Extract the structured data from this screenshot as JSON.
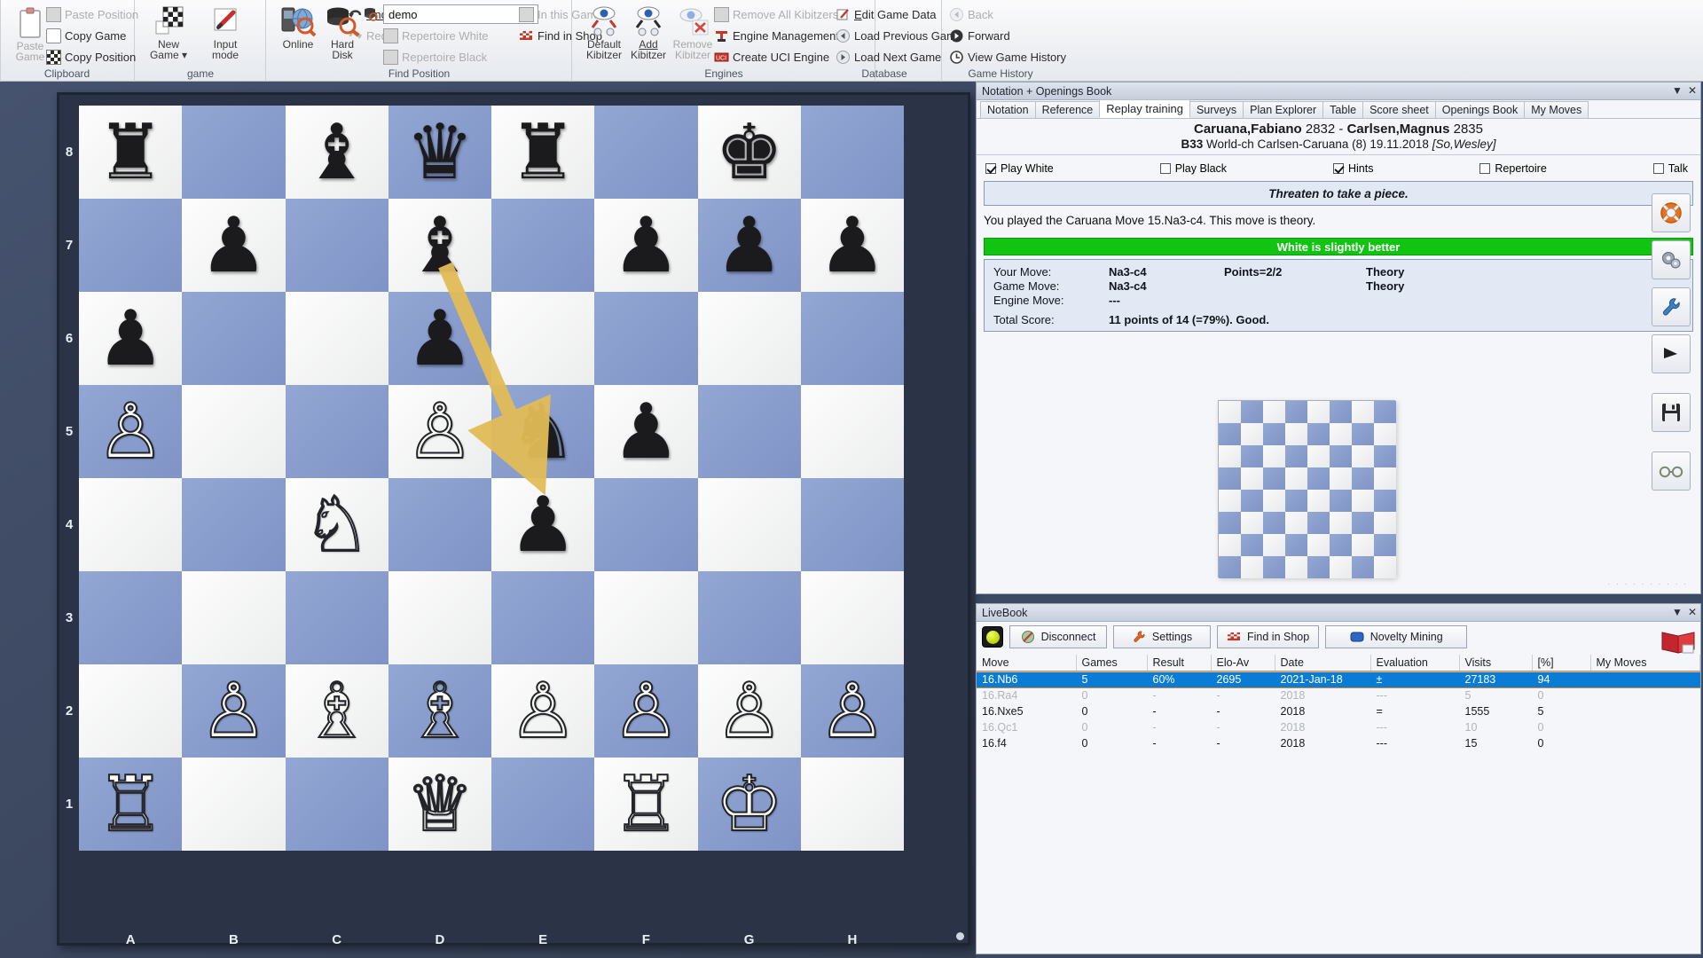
{
  "ribbon": {
    "groups": [
      {
        "name": "Clipboard",
        "label": "Clipboard"
      },
      {
        "name": "game",
        "label": "game"
      },
      {
        "name": "Find Position",
        "label": "Find Position"
      },
      {
        "name": "Engines",
        "label": "Engines"
      },
      {
        "name": "Database",
        "label": "Database"
      },
      {
        "name": "Game History",
        "label": "Game History"
      }
    ],
    "clipboard": {
      "paste_game": "Paste\nGame",
      "paste_game_l1": "Paste",
      "paste_game_l2": "Game",
      "paste_position": "Paste Position",
      "copy_game": "Copy Game",
      "copy_position": "Copy Position"
    },
    "game": {
      "new_game_l1": "New",
      "new_game_l2": "Game",
      "input_mode_l1": "Input",
      "input_mode_l2": "mode",
      "undo": "Undo",
      "redo": "Redo"
    },
    "find_position": {
      "online": "Online",
      "hard_disk_l1": "Hard",
      "hard_disk_l2": "Disk",
      "database_value": "demo",
      "repertoire_white": "Repertoire White",
      "repertoire_black": "Repertoire Black",
      "in_this_game": "In this Game",
      "find_in_shop": "Find in Shop"
    },
    "engines": {
      "default_kibitzer_l1": "Default",
      "default_kibitzer_l2": "Kibitzer",
      "add_kibitzer_l1": "Add",
      "add_kibitzer_l2": "Kibitzer",
      "remove_kibitzer_l1": "Remove",
      "remove_kibitzer_l2": "Kibitzer",
      "remove_all_kibitzers": "Remove All Kibitzers",
      "engine_management": "Engine Management",
      "create_uci_engine": "Create UCI Engine"
    },
    "database": {
      "edit_game_data": "Edit Game Data",
      "load_previous_game": "Load Previous Game",
      "load_next_game": "Load Next Game"
    },
    "game_history": {
      "back": "Back",
      "forward": "Forward",
      "view_game_history": "View Game History"
    }
  },
  "board": {
    "files": [
      "A",
      "B",
      "C",
      "D",
      "E",
      "F",
      "G",
      "H"
    ],
    "ranks": [
      "8",
      "7",
      "6",
      "5",
      "4",
      "3",
      "2",
      "1"
    ],
    "position": [
      [
        "r",
        "",
        "b",
        "q",
        "r",
        "",
        "k",
        ""
      ],
      [
        "",
        "p",
        "",
        "b",
        "",
        "p",
        "p",
        "p"
      ],
      [
        "p",
        "",
        "",
        "p",
        "",
        "",
        "",
        ""
      ],
      [
        "P",
        "",
        "",
        "P",
        "n",
        "p",
        "",
        ""
      ],
      [
        "",
        "",
        "N",
        "",
        "p",
        "",
        "",
        ""
      ],
      [
        "",
        "",
        "",
        "",
        "",
        "",
        "",
        ""
      ],
      [
        "",
        "P",
        "B",
        "B",
        "P",
        "P",
        "P",
        "P"
      ],
      [
        "R",
        "",
        "",
        "Q",
        "",
        "R",
        "K",
        ""
      ]
    ],
    "arrow": {
      "from": "d7",
      "to": "e5",
      "color": "#e8c260"
    }
  },
  "notation_panel": {
    "title": "Notation + Openings Book",
    "minimize_icon": "chevron-down",
    "close_icon": "close",
    "tabs": [
      {
        "label": "Notation",
        "active": false
      },
      {
        "label": "Reference",
        "active": false
      },
      {
        "label": "Replay training",
        "active": true
      },
      {
        "label": "Surveys",
        "active": false
      },
      {
        "label": "Plan Explorer",
        "active": false
      },
      {
        "label": "Table",
        "active": false
      },
      {
        "label": "Score sheet",
        "active": false
      },
      {
        "label": "Openings Book",
        "active": false
      },
      {
        "label": "My Moves",
        "active": false
      }
    ],
    "game_header": {
      "white_name": "Caruana,Fabiano",
      "white_elo": "2832",
      "dash": "-",
      "black_name": "Carlsen,Magnus",
      "black_elo": "2835",
      "eco": "B33",
      "event": "World-ch Carlsen-Caruana (8) 19.11.2018",
      "annotator": "[So,Wesley]"
    },
    "options": [
      {
        "label": "Play White",
        "checked": true
      },
      {
        "label": "Play Black",
        "checked": false
      },
      {
        "label": "Hints",
        "checked": true
      },
      {
        "label": "Repertoire",
        "checked": false
      },
      {
        "label": "Talk",
        "checked": false
      }
    ],
    "hint_text": "Threaten to take a piece.",
    "played_text": "You played the Caruana Move 15.Na3-c4. This move is theory.",
    "eval_text": "White is slightly better",
    "eval_color": "#12c412",
    "move_table": [
      {
        "label": "Your Move:",
        "value": "Na3-c4",
        "points": "Points=2/2",
        "theory": "Theory"
      },
      {
        "label": "Game Move:",
        "value": "Na3-c4",
        "points": "",
        "theory": "Theory"
      },
      {
        "label": "Engine Move:",
        "value": "---",
        "points": "",
        "theory": ""
      }
    ],
    "total_score_label": "Total Score:",
    "total_score_value": "11 points of 14 (=79%). Good.",
    "side_buttons": [
      {
        "name": "lifebuoy-icon",
        "glyph": "◎"
      },
      {
        "name": "gears-icon",
        "glyph": "⚙"
      },
      {
        "name": "wrench-icon",
        "glyph": "ὒ7"
      },
      {
        "name": "knight-flag-icon",
        "glyph": "♞"
      },
      {
        "name": "save-disk-icon",
        "glyph": "ὋE"
      },
      {
        "name": "glasses-icon",
        "glyph": "୯୯"
      }
    ]
  },
  "livebook_panel": {
    "title": "LiveBook",
    "minimize_icon": "chevron-down",
    "close_icon": "close",
    "toolbar": [
      {
        "label": "Disconnect",
        "icon": "disconnect-icon"
      },
      {
        "label": "Settings",
        "icon": "wrench-icon"
      },
      {
        "label": "Find in Shop",
        "icon": "checkered-flag-icon"
      },
      {
        "label": "Novelty Mining",
        "icon": "blue-box-icon"
      }
    ],
    "status_lamp": "green-lamp",
    "columns": [
      "Move",
      "Games",
      "Result",
      "Elo-Av",
      "Date",
      "Evaluation",
      "Visits",
      "[%]",
      "My Moves"
    ],
    "rows": [
      {
        "move": "16.Nb6",
        "games": "5",
        "result": "60%",
        "elo": "2695",
        "date": "2021-Jan-18",
        "evaluation": "±",
        "visits": "27183",
        "pct": "94",
        "mymoves": "",
        "selected": true,
        "dim": false
      },
      {
        "move": "16.Ra4",
        "games": "0",
        "result": "-",
        "elo": "-",
        "date": "2018",
        "evaluation": "---",
        "visits": "5",
        "pct": "0",
        "mymoves": "",
        "selected": false,
        "dim": true
      },
      {
        "move": "16.Nxe5",
        "games": "0",
        "result": "-",
        "elo": "-",
        "date": "2018",
        "evaluation": "=",
        "visits": "1555",
        "pct": "5",
        "mymoves": "",
        "selected": false,
        "dim": false
      },
      {
        "move": "16.Qc1",
        "games": "0",
        "result": "-",
        "elo": "-",
        "date": "2018",
        "evaluation": "---",
        "visits": "10",
        "pct": "0",
        "mymoves": "",
        "selected": false,
        "dim": true
      },
      {
        "move": "16.f4",
        "games": "0",
        "result": "-",
        "elo": "-",
        "date": "2018",
        "evaluation": "---",
        "visits": "15",
        "pct": "0",
        "mymoves": "",
        "selected": false,
        "dim": false
      }
    ]
  }
}
